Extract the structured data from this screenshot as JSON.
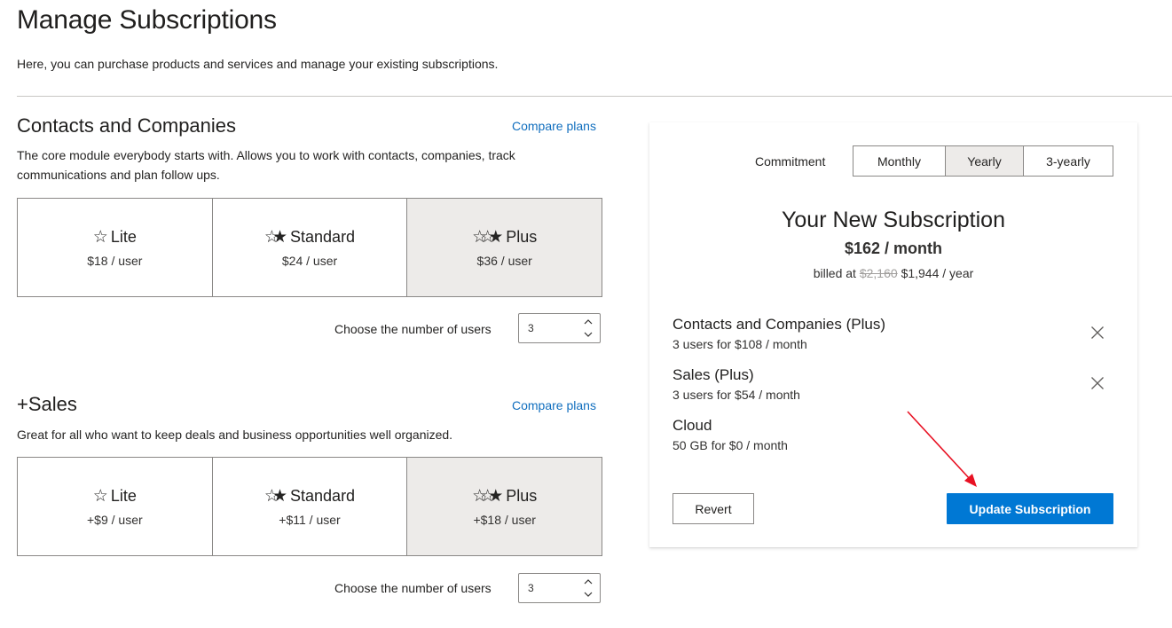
{
  "page": {
    "title": "Manage Subscriptions",
    "intro": "Here, you can purchase products and services and manage your existing subscriptions."
  },
  "contacts": {
    "title": "Contacts and Companies",
    "compare_link": "Compare plans",
    "description": "The core module everybody starts with. Allows you to work with contacts, companies, track communications and plan follow ups.",
    "plans": [
      {
        "name": "Lite",
        "price": "$18 / user",
        "selected": false
      },
      {
        "name": "Standard",
        "price": "$24 / user",
        "selected": false
      },
      {
        "name": "Plus",
        "price": "$36 / user",
        "selected": true
      }
    ],
    "users_label": "Choose the number of users",
    "users_value": "3"
  },
  "sales": {
    "title": "+Sales",
    "compare_link": "Compare plans",
    "description": "Great for all who want to keep deals and business opportunities well organized.",
    "plans": [
      {
        "name": "Lite",
        "price": "+$9 / user",
        "selected": false
      },
      {
        "name": "Standard",
        "price": "+$11 / user",
        "selected": false
      },
      {
        "name": "Plus",
        "price": "+$18 / user",
        "selected": true
      }
    ],
    "users_label": "Choose the number of users",
    "users_value": "3"
  },
  "summary": {
    "commitment_label": "Commitment",
    "commitment_options": [
      "Monthly",
      "Yearly",
      "3-yearly"
    ],
    "commitment_selected": "Yearly",
    "title": "Your New Subscription",
    "price": "$162 / month",
    "billed_prefix": "billed at",
    "billed_old": "$2,160",
    "billed_new": "$1,944 / year",
    "items": [
      {
        "title": "Contacts and Companies (Plus)",
        "detail": "3 users for $108 / month",
        "removable": true
      },
      {
        "title": "Sales (Plus)",
        "detail": "3 users for $54 / month",
        "removable": true
      },
      {
        "title": "Cloud",
        "detail": "50 GB for $0 / month",
        "removable": false
      }
    ],
    "revert_label": "Revert",
    "update_label": "Update Subscription"
  },
  "colors": {
    "accent": "#0078d4",
    "link": "#106ebe",
    "selected_bg": "#edebe9",
    "annotation": "#e81123"
  },
  "icons": {
    "lite": "star-outline-icon",
    "standard": "star-outline-filled-icon",
    "plus": "star-double-filled-icon",
    "remove": "close-icon",
    "stepper_up": "chevron-up-icon",
    "stepper_down": "chevron-down-icon"
  }
}
